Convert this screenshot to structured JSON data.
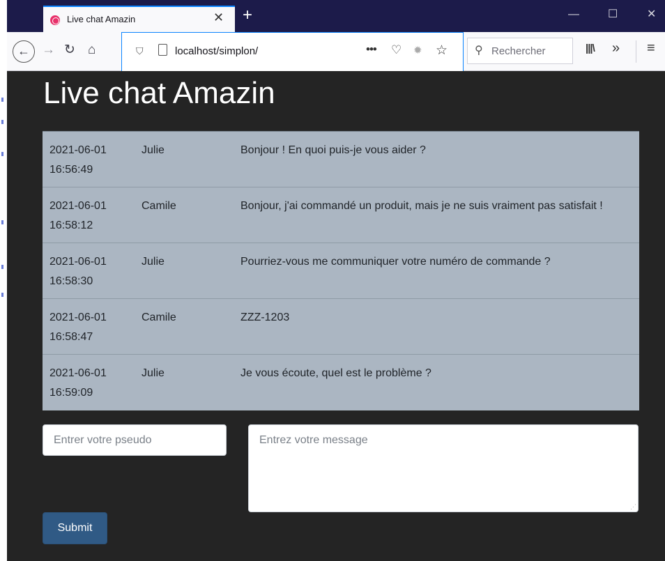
{
  "browser": {
    "tab_title": "Live chat Amazin",
    "tab_close": "✕",
    "new_tab": "+",
    "url": "localhost/simplon/",
    "search_placeholder": "Rechercher",
    "icons": {
      "back": "back-arrow-icon",
      "forward": "forward-arrow-icon",
      "reload": "reload-icon",
      "home": "home-icon",
      "more": "more-icon",
      "pocket": "pocket-icon",
      "extension": "bug-icon",
      "bookmark": "star-icon",
      "search": "search-icon",
      "library": "library-icon",
      "overflow": "overflow-icon",
      "menu": "hamburger-menu-icon"
    },
    "colors": {
      "tab_accent": "#0a84ff",
      "tabbar_bg": "#1c1b4a",
      "favicon": "#e8306a"
    }
  },
  "page": {
    "title": "Live chat Amazin",
    "messages": [
      {
        "date": "2021-06-01",
        "time": "16:56:49",
        "user": "Julie",
        "text": "Bonjour ! En quoi puis-je vous aider ?"
      },
      {
        "date": "2021-06-01",
        "time": "16:58:12",
        "user": "Camile",
        "text": "Bonjour, j'ai commandé un produit, mais je ne suis vraiment pas satisfait !"
      },
      {
        "date": "2021-06-01",
        "time": "16:58:30",
        "user": "Julie",
        "text": "Pourriez-vous me communiquer votre numéro de commande ?"
      },
      {
        "date": "2021-06-01",
        "time": "16:58:47",
        "user": "Camile",
        "text": "ZZZ-1203"
      },
      {
        "date": "2021-06-01",
        "time": "16:59:09",
        "user": "Julie",
        "text": "Je vous écoute, quel est le problème ?"
      }
    ],
    "form": {
      "pseudo_placeholder": "Entrer votre pseudo",
      "pseudo_value": "",
      "message_placeholder": "Entrez votre message",
      "message_value": "",
      "submit_label": "Submit"
    },
    "colors": {
      "background": "#242424",
      "table_bg": "#abb6c2",
      "submit_bg": "#305a85"
    }
  }
}
